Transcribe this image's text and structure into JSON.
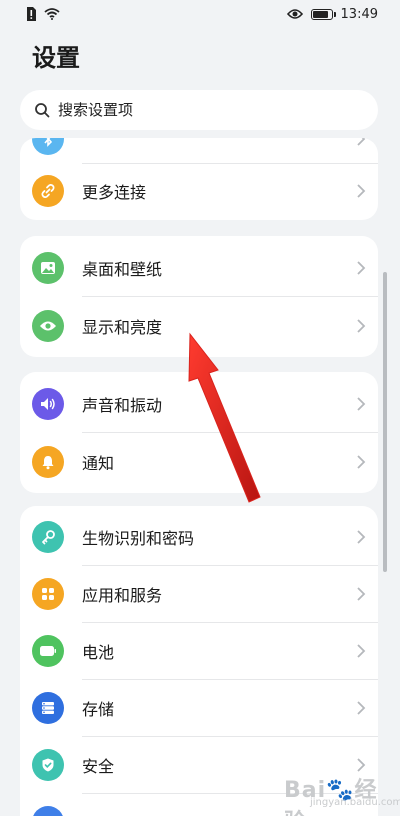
{
  "status_bar": {
    "time": "13:49",
    "icons": [
      "sim-alert-icon",
      "wifi-icon",
      "eye-icon",
      "battery-icon"
    ],
    "battery_level": 0.85
  },
  "page": {
    "title": "设置"
  },
  "search": {
    "placeholder": "搜索设置项"
  },
  "cards": [
    {
      "items": [
        {
          "label": "",
          "icon": "bluetooth-icon",
          "color": "#5ab6f0"
        },
        {
          "label": "更多连接",
          "icon": "link-icon",
          "color": "#f5a623"
        }
      ]
    },
    {
      "items": [
        {
          "label": "桌面和壁纸",
          "icon": "wallpaper-icon",
          "color": "#5cc16b"
        },
        {
          "label": "显示和亮度",
          "icon": "eye-icon",
          "color": "#5cc16b"
        }
      ]
    },
    {
      "items": [
        {
          "label": "声音和振动",
          "icon": "sound-icon",
          "color": "#6c5ae8"
        },
        {
          "label": "通知",
          "icon": "bell-icon",
          "color": "#f5a623"
        }
      ]
    },
    {
      "items": [
        {
          "label": "生物识别和密码",
          "icon": "key-icon",
          "color": "#3ec3b0"
        },
        {
          "label": "应用和服务",
          "icon": "apps-icon",
          "color": "#f5a623"
        },
        {
          "label": "电池",
          "icon": "battery-icon",
          "color": "#4fc35f"
        },
        {
          "label": "存储",
          "icon": "storage-icon",
          "color": "#2f6fdf"
        },
        {
          "label": "安全",
          "icon": "shield-icon",
          "color": "#3ec3b0"
        },
        {
          "label": "",
          "icon": "privacy-icon",
          "color": "#3f7fe8"
        }
      ]
    }
  ],
  "annotation": {
    "arrow_color": "#d9231d"
  },
  "watermark": {
    "text": "Bai🐾经验",
    "sub": "jingyan.baidu.com"
  }
}
